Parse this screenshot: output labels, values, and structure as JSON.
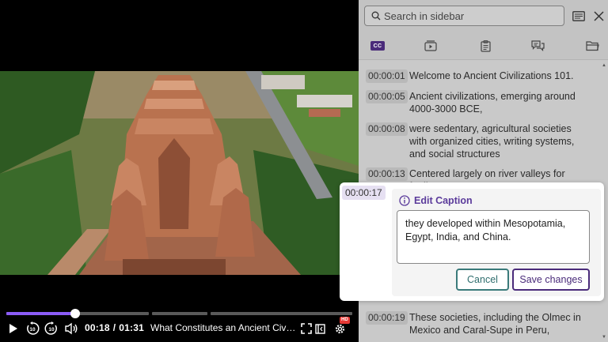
{
  "player": {
    "current_time": "00:18",
    "separator": "/",
    "duration": "01:31",
    "progress_fraction": 0.198,
    "title": "What Constitutes an Ancient Civilization?",
    "skip_back_label": "10",
    "skip_forward_label": "10",
    "hd_badge": "HD",
    "accent_color": "#8b5cf6"
  },
  "sidebar": {
    "search": {
      "placeholder": "Search in sidebar",
      "value": ""
    },
    "tabs": [
      "cc-icon",
      "playlist-icon",
      "notes-icon",
      "chat-icon",
      "folder-icon"
    ],
    "cc_label": "CC",
    "captions": [
      {
        "time": "00:00:01",
        "text": "Welcome to Ancient Civilizations 101."
      },
      {
        "time": "00:00:05",
        "text": "Ancient civilizations, emerging around 4000-3000 BCE,"
      },
      {
        "time": "00:00:08",
        "text": "were sedentary, agricultural societies with organized cities, writing systems, and social structures"
      },
      {
        "time": "00:00:13",
        "text": "Centered largely on river valleys for fertile"
      },
      {
        "time": "00:00:19",
        "text": "These societies, including the Olmec in Mexico and Caral-Supe in Peru,"
      }
    ]
  },
  "edit_caption": {
    "time": "00:00:17",
    "title": "Edit Caption",
    "text": "they developed within Mesopotamia, Egypt, India, and China.",
    "cancel_label": "Cancel",
    "save_label": "Save changes",
    "accent_color": "#4a2b7a"
  }
}
